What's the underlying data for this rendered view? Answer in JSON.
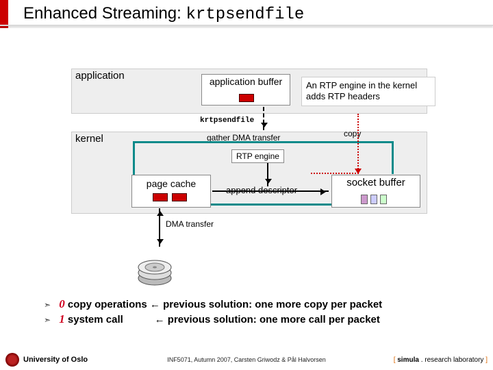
{
  "title": {
    "prefix": "Enhanced Streaming: ",
    "mono": "krtpsendfile"
  },
  "diagram": {
    "layer_app": "application",
    "layer_kernel": "kernel",
    "app_buffer": "application buffer",
    "note": "An RTP engine in the kernel adds RTP headers",
    "krt_label": "krtpsendfile",
    "rtp_engine": "RTP engine",
    "gather": "gather DMA transfer",
    "copy": "copy",
    "page_cache": "page cache",
    "append": "append descriptor",
    "socket_buffer": "socket buffer",
    "dma": "DMA transfer"
  },
  "bullets": {
    "b1_red": "0",
    "b1_rest": " copy operations ← previous solution: one more copy per packet",
    "b2_red": "1",
    "b2_rest": " system call           ← previous solution: one more call per packet"
  },
  "footer": {
    "uio": "University of Oslo",
    "course": "INF5071, Autumn 2007, Carsten Griwodz & Pål Halvorsen",
    "lab_bracket_l": "[ ",
    "lab_name": "simula",
    "lab_rest": " . research laboratory",
    "lab_bracket_r": " ]"
  }
}
